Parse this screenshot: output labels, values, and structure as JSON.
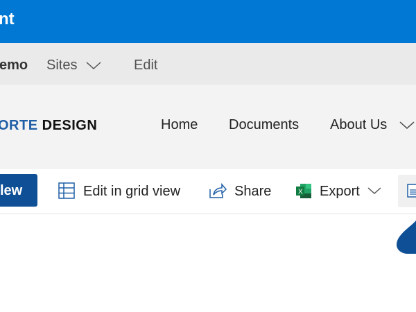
{
  "suite_bar": {
    "title_fragment": "nt"
  },
  "hub_bar": {
    "site_fragment": "emo",
    "sites_label": "Sites",
    "edit_label": "Edit"
  },
  "site_header": {
    "logo": {
      "part1": "ORTE",
      "part2": "DESIGN"
    },
    "nav": [
      {
        "label": "Home"
      },
      {
        "label": "Documents"
      },
      {
        "label": "About Us"
      }
    ]
  },
  "command_bar": {
    "new_fragment": "lew",
    "edit_grid_label": "Edit in grid view",
    "share_label": "Share",
    "export_label": "Export"
  },
  "colors": {
    "suite": "#0078d4",
    "primary_button": "#0f4f96",
    "logo_blue": "#1f5fa6",
    "excel": "#1d7a45"
  }
}
